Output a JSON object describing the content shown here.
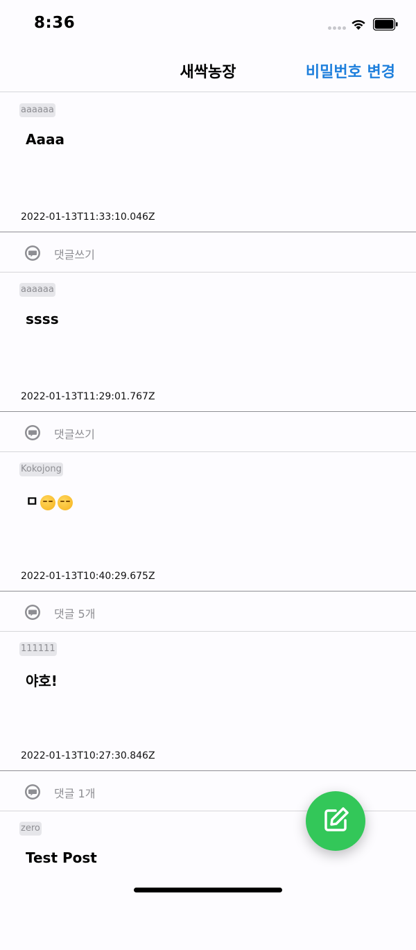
{
  "status_bar": {
    "time": "8:36"
  },
  "header": {
    "title": "새싹농장",
    "action_label": "비밀번호 변경"
  },
  "posts": [
    {
      "author": "aaaaaa",
      "content": "Aaaa",
      "date": "2022-01-13T11:33:10.046Z",
      "comment_label": "댓글쓰기"
    },
    {
      "author": "aaaaaa",
      "content": "ssss",
      "date": "2022-01-13T11:29:01.767Z",
      "comment_label": "댓글쓰기"
    },
    {
      "author": "Kokojong",
      "content_prefix": "ㅁ",
      "emojis": [
        "unamused-face",
        "unamused-face"
      ],
      "date": "2022-01-13T10:40:29.675Z",
      "comment_label": "댓글 5개"
    },
    {
      "author": "111111",
      "content": "야호!",
      "date": "2022-01-13T10:27:30.846Z",
      "comment_label": "댓글 1개"
    },
    {
      "author": "zero",
      "content": "Test Post"
    }
  ],
  "colors": {
    "accent": "#1e7fdc",
    "fab": "#33c759",
    "badge_bg": "#e6e6ea",
    "muted_text": "#8e8e93"
  },
  "icons": {
    "comment": "speech-bubble-icon",
    "fab": "compose-icon"
  }
}
